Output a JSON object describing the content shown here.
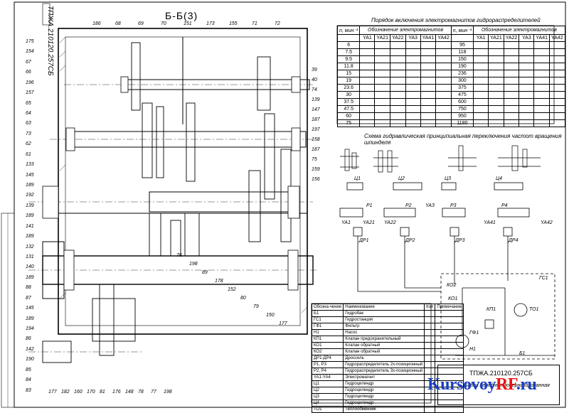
{
  "drawing_code": "ТПЖА.210120.257СБ",
  "section_label": "Б-Б(3)",
  "table_caption": "Порядок включения электромагнитов гидрораспределителей",
  "scheme_caption": "Схема гидравлическая принципиальная переключения частот вращения шпинделя",
  "order_table": {
    "col_n": "n, мин⁻¹",
    "col_group": "Обозначение электромагнитов",
    "magnets": [
      "YA1",
      "YA21",
      "YA22",
      "YA3",
      "YA41",
      "YA42"
    ],
    "left_speeds": [
      "6",
      "7.5",
      "9.5",
      "11.8",
      "15",
      "19",
      "23.6",
      "30",
      "37.5",
      "47.5",
      "60",
      "75"
    ],
    "right_speeds": [
      "95",
      "118",
      "150",
      "190",
      "236",
      "300",
      "375",
      "475",
      "600",
      "750",
      "950",
      "1180"
    ]
  },
  "parts_table": {
    "headers": [
      "Обозна-чение",
      "Наименование",
      "Кол",
      "Примечание"
    ],
    "rows": [
      [
        "Б1",
        "Гидробак"
      ],
      [
        "ГС1",
        "Гидростанция"
      ],
      [
        "ГФ1",
        "Фильтр"
      ],
      [
        "Н1",
        "Насос"
      ],
      [
        "КП1",
        "Клапан предохранительный"
      ],
      [
        "КО1",
        "Клапан обратный"
      ],
      [
        "КО2",
        "Клапан обратный"
      ],
      [
        "ДР1-ДР4",
        "Дроссель"
      ],
      [
        "Р1, Р3",
        "Гидрораспределитель 2х-позиционный"
      ],
      [
        "Р2, Р4",
        "Гидрораспределитель 3х-позиционный"
      ],
      [
        "YA1-YA4",
        "Электромагнит"
      ],
      [
        "Ц1",
        "Гидроцилиндр"
      ],
      [
        "Ц2",
        "Гидроцилиндр"
      ],
      [
        "Ц3",
        "Гидроцилиндр"
      ],
      [
        "Ц4",
        "Гидроцилиндр"
      ],
      [
        "ТО1",
        "Теплообменник"
      ]
    ]
  },
  "title_block": {
    "code": "ТПЖА.210120.257СБ",
    "name": "Бабка передняя модернизированная"
  },
  "logo": {
    "main": "Kursovoy",
    "accent": "RF",
    "suffix": ".ru"
  },
  "left_callouts": [
    "175",
    "154",
    "67",
    "66",
    "196",
    "157",
    "65",
    "64",
    "63",
    "73",
    "62",
    "61",
    "133",
    "145",
    "189",
    "192",
    "139",
    "189",
    "141",
    "189",
    "132",
    "131",
    "140",
    "189",
    "88",
    "87",
    "145",
    "189",
    "194",
    "86",
    "142",
    "190",
    "85",
    "84",
    "83"
  ],
  "top_callouts": [
    "186",
    "68",
    "69",
    "70",
    "151",
    "173",
    "155",
    "71",
    "72"
  ],
  "right_callouts": [
    "39",
    "40",
    "74",
    "139",
    "147",
    "187",
    "197",
    "158",
    "187",
    "75",
    "159",
    "156"
  ],
  "bottom_callouts": [
    "177",
    "182",
    "160",
    "170",
    "81",
    "176",
    "148",
    "78",
    "77",
    "198",
    "76",
    "198",
    "89",
    "178",
    "152",
    "80",
    "79",
    "150",
    "177"
  ],
  "hydraulic_labels": [
    "Ц1",
    "Ц2",
    "Ц3",
    "Ц4",
    "Р1",
    "Р2",
    "Р3",
    "Р4",
    "YA1",
    "YA21",
    "YA22",
    "YA3",
    "YA41",
    "YA42",
    "ДР1",
    "ДР2",
    "ДР3",
    "ДР4",
    "КО2",
    "КО1",
    "КП1",
    "ТО1",
    "ГФ1",
    "Н1",
    "Б1",
    "ГС1"
  ]
}
